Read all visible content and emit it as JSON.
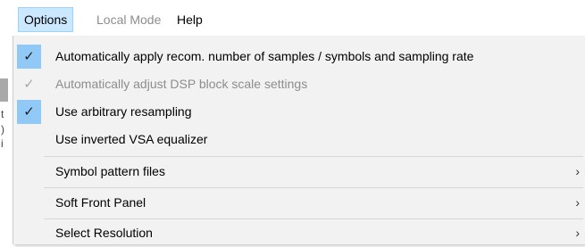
{
  "menubar": {
    "options_label": "Options",
    "local_mode_label": "Local Mode",
    "help_label": "Help"
  },
  "background_fragments": [
    "tf",
    "t",
    ")",
    "i"
  ],
  "menu": {
    "items": [
      {
        "label": "Automatically apply recom. number of samples / symbols and sampling rate",
        "checked": true,
        "enabled": true
      },
      {
        "label": "Automatically adjust DSP block scale settings",
        "checked": true,
        "enabled": false
      },
      {
        "label": "Use arbitrary resampling",
        "checked": true,
        "enabled": true
      },
      {
        "label": "Use inverted VSA equalizer",
        "checked": false,
        "enabled": true
      }
    ],
    "submenus": [
      {
        "label": "Symbol pattern files",
        "arrow": "›"
      },
      {
        "label": "Soft Front Panel",
        "arrow": "›"
      },
      {
        "label": "Select Resolution",
        "arrow": "›"
      }
    ],
    "check_glyph": "✓"
  },
  "colors": {
    "highlight": "#cce8ff",
    "check_bg": "#90c8f6",
    "menu_bg": "#f2f2f2"
  }
}
